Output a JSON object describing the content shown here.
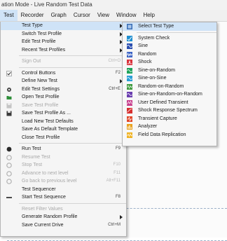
{
  "window": {
    "title": "ation Mode - Live Random Test Data"
  },
  "menubar": {
    "items": [
      {
        "label": "Test"
      },
      {
        "label": "Recorder"
      },
      {
        "label": "Graph"
      },
      {
        "label": "Cursor"
      },
      {
        "label": "View"
      },
      {
        "label": "Window"
      },
      {
        "label": "Help"
      }
    ]
  },
  "test_menu": {
    "items": [
      {
        "label": "Test Type",
        "submenu": true,
        "highlighted": true
      },
      {
        "label": "Switch Test Profile",
        "submenu": true
      },
      {
        "label": "Edit Test Profile",
        "submenu": true
      },
      {
        "label": "Recent Test Profiles",
        "submenu": true
      },
      {
        "label": "Sign Out",
        "shortcut": "Ctrl+O",
        "disabled": true
      },
      {
        "label": "Control Buttons",
        "shortcut": "F2",
        "icon": "checkmark-icon"
      },
      {
        "label": "Define New Test",
        "submenu": true
      },
      {
        "label": "Edit Test Settings",
        "shortcut": "Ctrl+E",
        "icon": "settings-icon"
      },
      {
        "label": "Open Test Profile",
        "icon": "open-folder-icon"
      },
      {
        "label": "Save Test Profile",
        "disabled": true,
        "icon": "save-icon"
      },
      {
        "label": "Save Test Profile As ...",
        "icon": "save-as-icon"
      },
      {
        "label": "Load New Test Defaults"
      },
      {
        "label": "Save As Default Template"
      },
      {
        "label": "Close Test Profile"
      },
      {
        "label": "Run Test",
        "shortcut": "F9",
        "icon": "run-icon"
      },
      {
        "label": "Resume Test",
        "disabled": true,
        "icon": "resume-icon"
      },
      {
        "label": "Stop Test",
        "shortcut": "F10",
        "disabled": true,
        "icon": "stop-icon"
      },
      {
        "label": "Advance to next level",
        "shortcut": "F11",
        "disabled": true,
        "icon": "advance-icon"
      },
      {
        "label": "Go back to previous level",
        "shortcut": "Alt+F11",
        "disabled": true,
        "icon": "go-back-icon"
      },
      {
        "label": "Test Sequencer"
      },
      {
        "label": "Start Test Sequence",
        "shortcut": "F8",
        "icon": "sequence-icon"
      },
      {
        "label": "Reset Filter Values",
        "disabled": true
      },
      {
        "label": "Generate Random Profile",
        "submenu": true
      },
      {
        "label": "Save Current Drive",
        "shortcut": "Ctrl+M"
      }
    ]
  },
  "test_type_submenu": {
    "items": [
      {
        "label": "Select Test Type",
        "highlighted": true
      },
      {
        "label": "System Check"
      },
      {
        "label": "Sine"
      },
      {
        "label": "Random"
      },
      {
        "label": "Shock"
      },
      {
        "label": "Sine-on-Random"
      },
      {
        "label": "Sine-on-Sine"
      },
      {
        "label": "Random-on-Random"
      },
      {
        "label": "Sine-on-Random-on-Random"
      },
      {
        "label": "User Defined Transient"
      },
      {
        "label": "Shock Response Spectrum"
      },
      {
        "label": "Transient Capture"
      },
      {
        "label": "Analyzer"
      },
      {
        "label": "Field Data Replication"
      }
    ]
  },
  "colors": {
    "highlight": "#cfe3f7",
    "menu_bg": "#f5f5f5",
    "disabled_text": "#a8a8a8"
  }
}
